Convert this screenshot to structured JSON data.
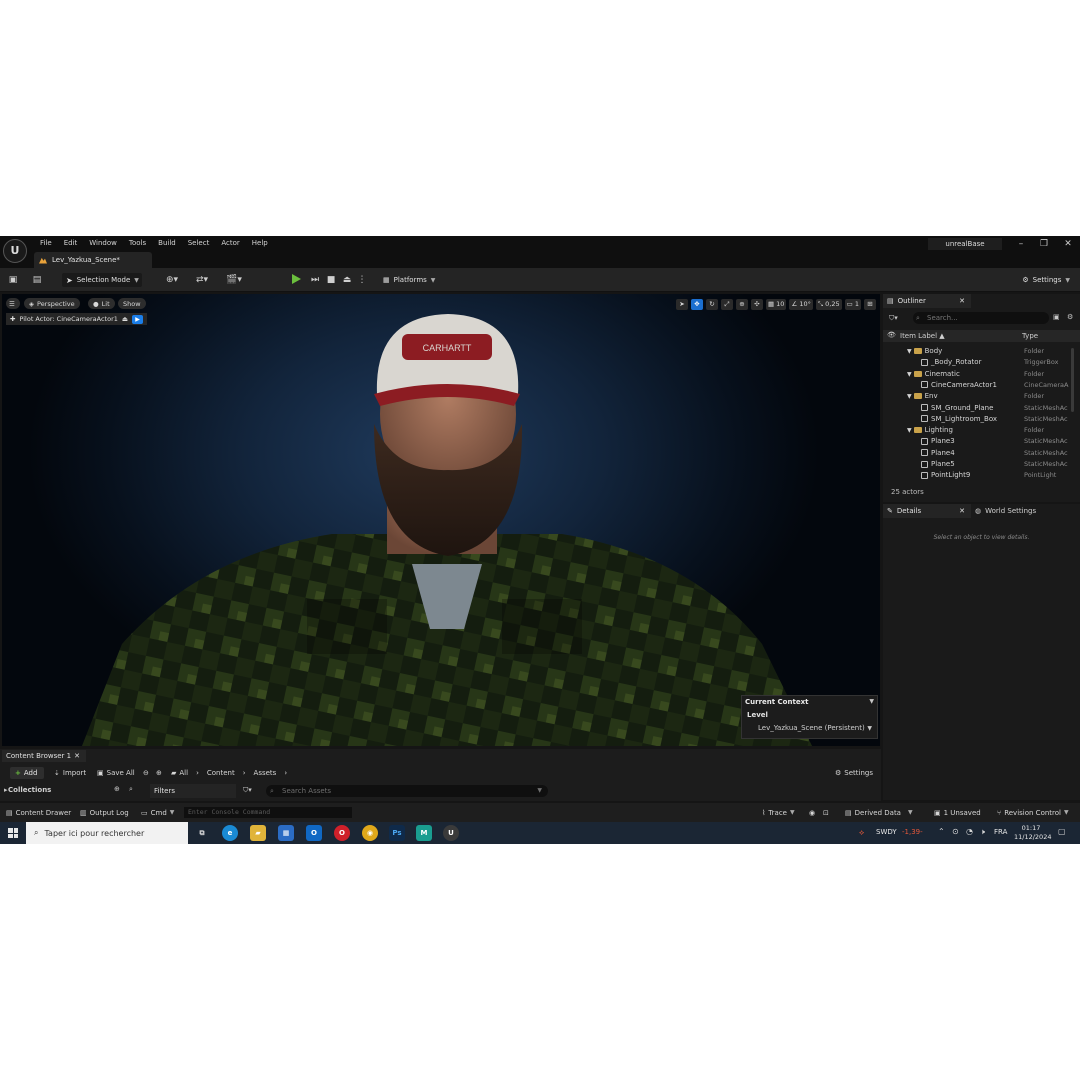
{
  "menu": [
    "File",
    "Edit",
    "Window",
    "Tools",
    "Build",
    "Select",
    "Actor",
    "Help"
  ],
  "level_tab": "Lev_Yazkua_Scene*",
  "project_name": "unrealBase",
  "toolbar": {
    "selection_mode": "Selection Mode",
    "platforms": "Platforms",
    "settings": "Settings"
  },
  "viewport": {
    "perspective": "Perspective",
    "lit": "Lit",
    "show": "Show",
    "pilot_actor": "Pilot Actor: CineCameraActor1",
    "grid_size": "10",
    "rotation_snap": "10°",
    "scale_snap": "0,25",
    "camera_speed": "1",
    "cap_text": "CARHARTT"
  },
  "context": {
    "title": "Current Context",
    "level_label": "Level",
    "level_value": "Lev_Yazkua_Scene (Persistent)"
  },
  "outliner": {
    "tab": "Outliner",
    "search_placeholder": "Search...",
    "col_label": "Item Label ▲",
    "col_type": "Type",
    "rows": [
      {
        "label": "Body",
        "type": "Folder",
        "indent": 2,
        "kind": "folder"
      },
      {
        "label": "_Body_Rotator",
        "type": "TriggerBox",
        "indent": 3,
        "kind": "actor"
      },
      {
        "label": "Cinematic",
        "type": "Folder",
        "indent": 2,
        "kind": "folder"
      },
      {
        "label": "CineCameraActor1",
        "type": "CineCameraA",
        "indent": 3,
        "kind": "actor"
      },
      {
        "label": "Env",
        "type": "Folder",
        "indent": 2,
        "kind": "folder"
      },
      {
        "label": "SM_Ground_Plane",
        "type": "StaticMeshAc",
        "indent": 3,
        "kind": "actor"
      },
      {
        "label": "SM_Lightroom_Box",
        "type": "StaticMeshAc",
        "indent": 3,
        "kind": "actor"
      },
      {
        "label": "Lighting",
        "type": "Folder",
        "indent": 2,
        "kind": "folder"
      },
      {
        "label": "Plane3",
        "type": "StaticMeshAc",
        "indent": 3,
        "kind": "actor"
      },
      {
        "label": "Plane4",
        "type": "StaticMeshAc",
        "indent": 3,
        "kind": "actor"
      },
      {
        "label": "Plane5",
        "type": "StaticMeshAc",
        "indent": 3,
        "kind": "actor"
      },
      {
        "label": "PointLight9",
        "type": "PointLight",
        "indent": 3,
        "kind": "actor"
      }
    ],
    "actor_count": "25 actors"
  },
  "details": {
    "tab": "Details",
    "world_tab": "World Settings",
    "hint": "Select an object to view details."
  },
  "content_browser": {
    "tab": "Content Browser 1",
    "add": "Add",
    "import": "Import",
    "save_all": "Save All",
    "path": [
      "All",
      "Content",
      "Assets"
    ],
    "settings": "Settings",
    "collections": "Collections",
    "filters": "Filters",
    "search_placeholder": "Search Assets"
  },
  "statusbar": {
    "content_drawer": "Content Drawer",
    "output_log": "Output Log",
    "cmd": "Cmd",
    "console_placeholder": "Enter Console Command",
    "trace": "Trace",
    "derived_data": "Derived Data",
    "unsaved": "1 Unsaved",
    "revision_control": "Revision Control"
  },
  "taskbar": {
    "search_placeholder": "Taper ici pour rechercher",
    "ticker": "SWDY",
    "change": "-1,39-",
    "lang": "FRA",
    "time": "01:17",
    "date": "11/12/2024"
  }
}
